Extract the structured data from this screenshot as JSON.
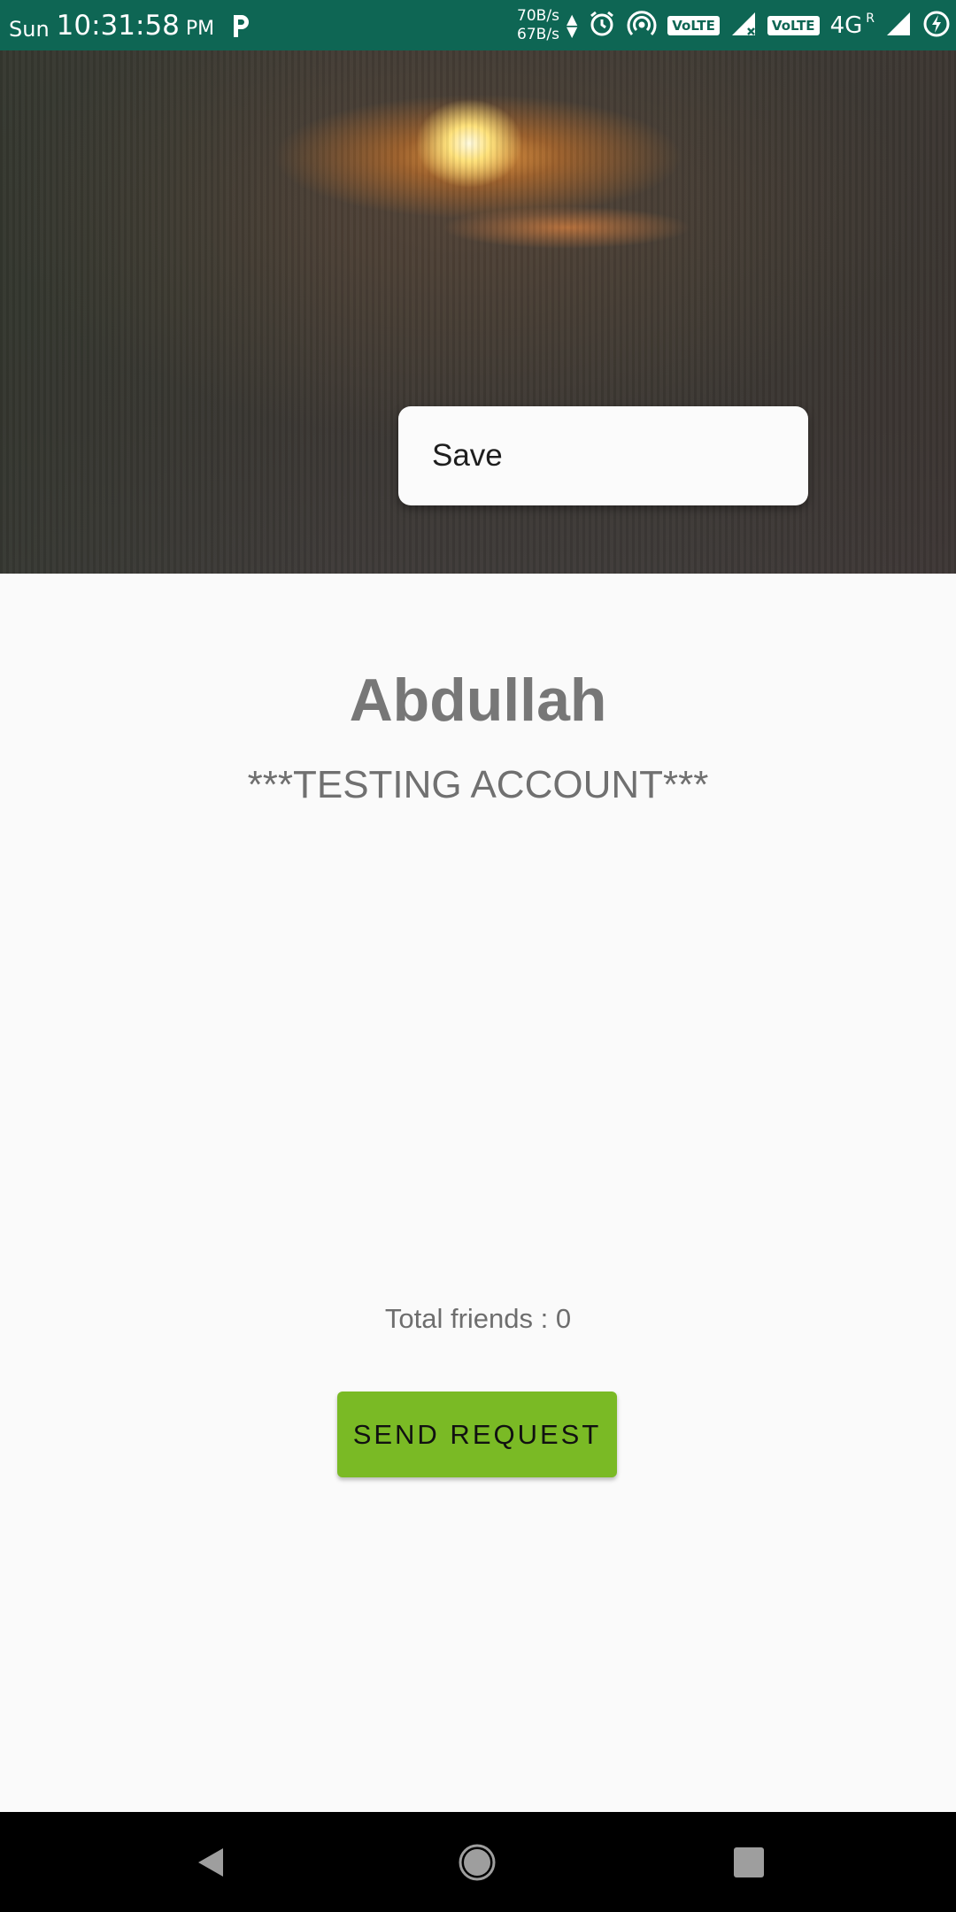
{
  "status_bar": {
    "day": "Sun",
    "time": "10:31:58",
    "ampm": "PM",
    "speed_up": "70B/s",
    "speed_down": "67B/s",
    "volte_1": "VoLTE",
    "volte_2": "VoLTE",
    "network": "4G",
    "roaming": "R"
  },
  "popup_menu": {
    "items": [
      {
        "label": "Save"
      }
    ]
  },
  "profile": {
    "name": "Abdullah",
    "status": "***TESTING ACCOUNT***",
    "total_friends": "Total friends : 0"
  },
  "actions": {
    "send_request_label": "SEND REQUEST"
  },
  "colors": {
    "status_bar": "#0e6654",
    "button": "#7aba25",
    "background": "#fafafa"
  },
  "icons": [
    "parking-icon",
    "alarm-icon",
    "hotspot-icon",
    "signal-icon",
    "battery-icon",
    "back-icon",
    "home-icon",
    "recents-icon"
  ]
}
